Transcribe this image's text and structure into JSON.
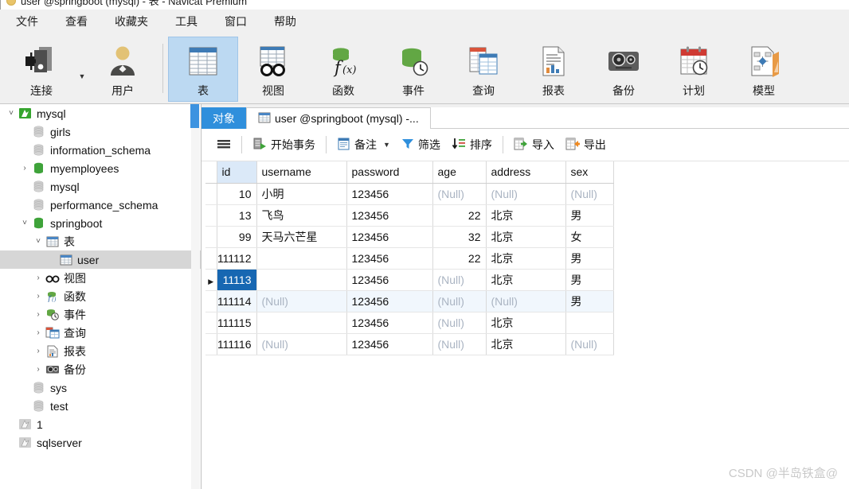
{
  "window": {
    "title": "user @springboot (mysql) - 表 - Navicat Premium"
  },
  "menubar": {
    "items": [
      {
        "label": "文件",
        "name": "menu-file"
      },
      {
        "label": "查看",
        "name": "menu-view"
      },
      {
        "label": "收藏夹",
        "name": "menu-favorites"
      },
      {
        "label": "工具",
        "name": "menu-tools"
      },
      {
        "label": "窗口",
        "name": "menu-window"
      },
      {
        "label": "帮助",
        "name": "menu-help"
      }
    ]
  },
  "toolbar": {
    "buttons": [
      {
        "label": "连接",
        "icon": "connection-icon",
        "selected": false
      },
      {
        "label": "用户",
        "icon": "user-icon",
        "selected": false
      },
      {
        "label": "表",
        "icon": "table-icon",
        "selected": true
      },
      {
        "label": "视图",
        "icon": "view-icon",
        "selected": false
      },
      {
        "label": "函数",
        "icon": "function-icon",
        "selected": false
      },
      {
        "label": "事件",
        "icon": "event-icon",
        "selected": false
      },
      {
        "label": "查询",
        "icon": "query-icon",
        "selected": false
      },
      {
        "label": "报表",
        "icon": "report-icon",
        "selected": false
      },
      {
        "label": "备份",
        "icon": "backup-icon",
        "selected": false
      },
      {
        "label": "计划",
        "icon": "schedule-icon",
        "selected": false
      },
      {
        "label": "模型",
        "icon": "model-icon",
        "selected": false
      }
    ]
  },
  "sidebar": {
    "items": [
      {
        "label": "mysql",
        "icon": "connection-mysql-icon",
        "indent": 0,
        "twisty": "expanded",
        "selected": false
      },
      {
        "label": "girls",
        "icon": "database-gray-icon",
        "indent": 1,
        "twisty": "none",
        "selected": false
      },
      {
        "label": "information_schema",
        "icon": "database-gray-icon",
        "indent": 1,
        "twisty": "none",
        "selected": false
      },
      {
        "label": "myemployees",
        "icon": "database-green-icon",
        "indent": 1,
        "twisty": "collapsed",
        "selected": false
      },
      {
        "label": "mysql",
        "icon": "database-gray-icon",
        "indent": 1,
        "twisty": "none",
        "selected": false
      },
      {
        "label": "performance_schema",
        "icon": "database-gray-icon",
        "indent": 1,
        "twisty": "none",
        "selected": false
      },
      {
        "label": "springboot",
        "icon": "database-green-icon",
        "indent": 1,
        "twisty": "expanded",
        "selected": false
      },
      {
        "label": "表",
        "icon": "table-icon",
        "indent": 2,
        "twisty": "expanded",
        "selected": false
      },
      {
        "label": "user",
        "icon": "table-icon",
        "indent": 3,
        "twisty": "none",
        "selected": true
      },
      {
        "label": "视图",
        "icon": "view-icon",
        "indent": 2,
        "twisty": "collapsed",
        "selected": false
      },
      {
        "label": "函数",
        "icon": "function-icon",
        "indent": 2,
        "twisty": "collapsed",
        "selected": false
      },
      {
        "label": "事件",
        "icon": "event-icon",
        "indent": 2,
        "twisty": "collapsed",
        "selected": false
      },
      {
        "label": "查询",
        "icon": "query-icon",
        "indent": 2,
        "twisty": "collapsed",
        "selected": false
      },
      {
        "label": "报表",
        "icon": "report-icon",
        "indent": 2,
        "twisty": "collapsed",
        "selected": false
      },
      {
        "label": "备份",
        "icon": "backup-icon",
        "indent": 2,
        "twisty": "collapsed",
        "selected": false
      },
      {
        "label": "sys",
        "icon": "database-gray-icon",
        "indent": 1,
        "twisty": "none",
        "selected": false
      },
      {
        "label": "test",
        "icon": "database-gray-icon",
        "indent": 1,
        "twisty": "none",
        "selected": false
      },
      {
        "label": "1",
        "icon": "connection-gray-icon",
        "indent": 0,
        "twisty": "none",
        "selected": false
      },
      {
        "label": "sqlserver",
        "icon": "connection-gray-icon",
        "indent": 0,
        "twisty": "none",
        "selected": false
      }
    ]
  },
  "tabs": {
    "items": [
      {
        "label": "对象",
        "icon": "none",
        "active": true
      },
      {
        "label": "user @springboot (mysql) -...",
        "icon": "table-icon",
        "active": false
      }
    ]
  },
  "gridbar": {
    "buttons": [
      {
        "label": "",
        "icon": "grid-menu-icon",
        "caret": false
      },
      {
        "label": "开始事务",
        "icon": "begin-transaction-icon",
        "caret": false
      },
      {
        "label": "备注",
        "icon": "note-icon",
        "caret": true
      },
      {
        "label": "筛选",
        "icon": "filter-icon",
        "caret": false
      },
      {
        "label": "排序",
        "icon": "sort-icon",
        "caret": false
      },
      {
        "label": "导入",
        "icon": "import-icon",
        "caret": false
      },
      {
        "label": "导出",
        "icon": "export-icon",
        "caret": false
      }
    ]
  },
  "table": {
    "columns": [
      "id",
      "username",
      "password",
      "age",
      "address",
      "sex"
    ],
    "highlighted_column": "id",
    "null_text": "(Null)",
    "rows": [
      {
        "id": "10",
        "id_clipped": false,
        "username": "小明",
        "password": "123456",
        "age": "(Null)",
        "address": "(Null)",
        "sex": "(Null)",
        "state": "normal",
        "selected_cell": null
      },
      {
        "id": "13",
        "id_clipped": false,
        "username": "飞鸟",
        "password": "123456",
        "age": "22",
        "address": "北京",
        "sex": "男",
        "state": "normal",
        "selected_cell": null
      },
      {
        "id": "99",
        "id_clipped": false,
        "username": "天马六芒星",
        "password": "123456",
        "age": "32",
        "address": "北京",
        "sex": "女",
        "state": "normal",
        "selected_cell": null
      },
      {
        "id": "111112",
        "id_clipped": true,
        "username": "",
        "password": "123456",
        "age": "22",
        "address": "北京",
        "sex": "男",
        "state": "normal",
        "selected_cell": null
      },
      {
        "id": "11113",
        "id_clipped": false,
        "username": "",
        "password": "123456",
        "age": "(Null)",
        "address": "北京",
        "sex": "男",
        "state": "current",
        "selected_cell": "id"
      },
      {
        "id": "111114",
        "id_clipped": true,
        "username": "(Null)",
        "password": "123456",
        "age": "(Null)",
        "address": "(Null)",
        "sex": "男",
        "state": "hover",
        "selected_cell": null
      },
      {
        "id": "111115",
        "id_clipped": true,
        "username": "",
        "password": "123456",
        "age": "(Null)",
        "address": "北京",
        "sex": "",
        "state": "normal",
        "selected_cell": null
      },
      {
        "id": "111116",
        "id_clipped": true,
        "username": "(Null)",
        "password": "123456",
        "age": "(Null)",
        "address": "北京",
        "sex": "(Null)",
        "state": "normal",
        "selected_cell": null
      }
    ]
  },
  "watermark": {
    "text": "CSDN @半岛铁盒@"
  }
}
